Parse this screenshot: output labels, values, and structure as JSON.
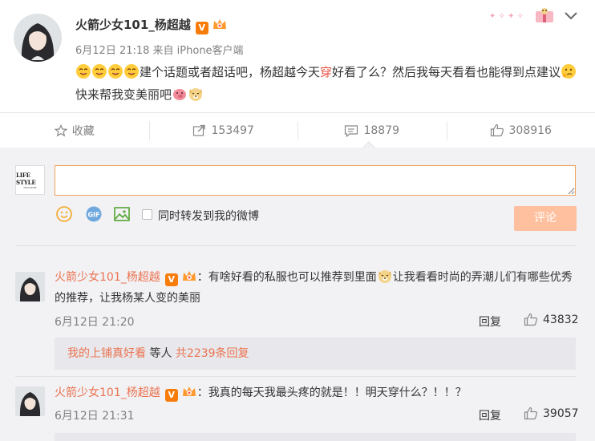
{
  "post": {
    "username": "火箭少女101_杨超越",
    "verified_badge": "V",
    "meta": "6月12日 21:18 来自 iPhone客户端",
    "text_part1": "建个话题或者超话吧，杨超越今天",
    "text_red": "穿",
    "text_part2": "好看了么？然后我每天看看也能得到点建议",
    "text_part3": "快来帮我变美丽吧",
    "emoji_icons": [
      "yummy-face-icon",
      "thinking-face-icon",
      "pig-icon",
      "doge-icon"
    ],
    "decoration": "gift-sticker-icon"
  },
  "actions": [
    {
      "icon": "star-icon",
      "label": "收藏"
    },
    {
      "icon": "share-icon",
      "label": "153497"
    },
    {
      "icon": "comment-icon",
      "label": "18879"
    },
    {
      "icon": "thumbs-up-icon",
      "label": "308916"
    }
  ],
  "composer": {
    "avatar_logo_line1": "LIFE STYLE",
    "avatar_logo_line2": "MAGAZINE",
    "placeholder": "",
    "repost_label": "同时转发到我的微博",
    "submit_label": "评论",
    "tools": [
      "emoji-icon",
      "gif-icon",
      "image-icon"
    ]
  },
  "comments": [
    {
      "username": "火箭少女101_杨超越",
      "text_before": "：有啥好看的私服也可以推荐到里面",
      "text_after": "让我看看时尚的弄潮儿们有哪些优秀的推荐，让我杨某人变的美丽",
      "time": "6月12日 21:20",
      "reply_label": "回复",
      "likes": "43832",
      "sub_user": "我的上铺真好看",
      "sub_mid": " 等人 ",
      "sub_count": "共2239条回复"
    },
    {
      "username": "火箭少女101_杨超越",
      "text_before": "：我真的每天我最头疼的就是！！明天穿什么？！！？",
      "text_after": "",
      "time": "6月12日 21:31",
      "reply_label": "回复",
      "likes": "39057"
    }
  ],
  "colors": {
    "accent": "#eb7350",
    "submit_disabled": "#ffc09f",
    "badge_orange": "#f77c0a",
    "background_gray": "#f2f2f5"
  }
}
